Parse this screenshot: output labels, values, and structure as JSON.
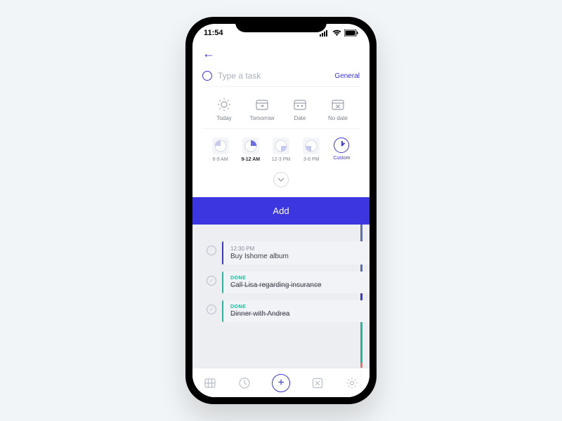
{
  "statusbar": {
    "time": "11:54"
  },
  "input": {
    "placeholder": "Type a task",
    "category": "General"
  },
  "dateOptions": [
    {
      "label": "Today"
    },
    {
      "label": "Tomorrow"
    },
    {
      "label": "Date"
    },
    {
      "label": "No date"
    }
  ],
  "timeOptions": [
    {
      "label": "6-9 AM"
    },
    {
      "label": "9-12 AM"
    },
    {
      "label": "12-3 PM"
    },
    {
      "label": "3-6 PM"
    },
    {
      "label": "Custom"
    }
  ],
  "addButton": "Add",
  "tasks": [
    {
      "time": "12:30 PM",
      "title": "Buy Ishome album",
      "status": ""
    },
    {
      "time": "",
      "title": "Call Lisa regarding insurance",
      "status": "DONE"
    },
    {
      "time": "",
      "title": "Dinner with Andrea",
      "status": "DONE"
    }
  ],
  "colors": {
    "accent": "#3b36e0",
    "done": "#1abc9c"
  }
}
